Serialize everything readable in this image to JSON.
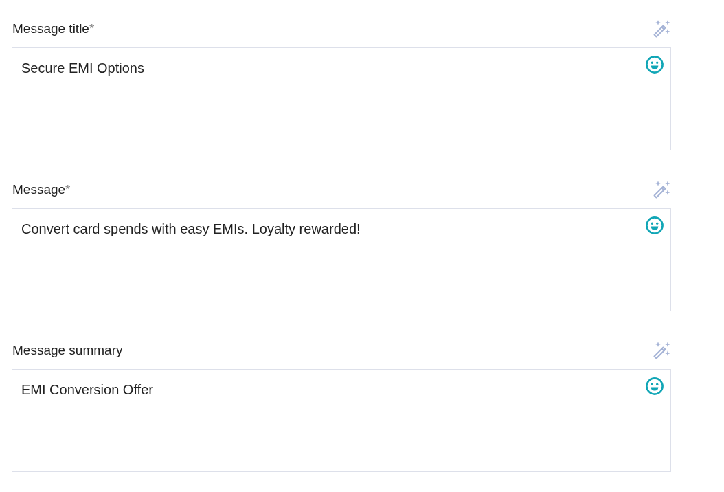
{
  "fields": [
    {
      "label": "Message title",
      "required_mark": "*",
      "value": "Secure EMI Options"
    },
    {
      "label": "Message",
      "required_mark": "*",
      "value": "Convert card spends with easy EMIs. Loyalty rewarded!"
    },
    {
      "label": "Message summary",
      "value": "EMI Conversion Offer"
    }
  ]
}
